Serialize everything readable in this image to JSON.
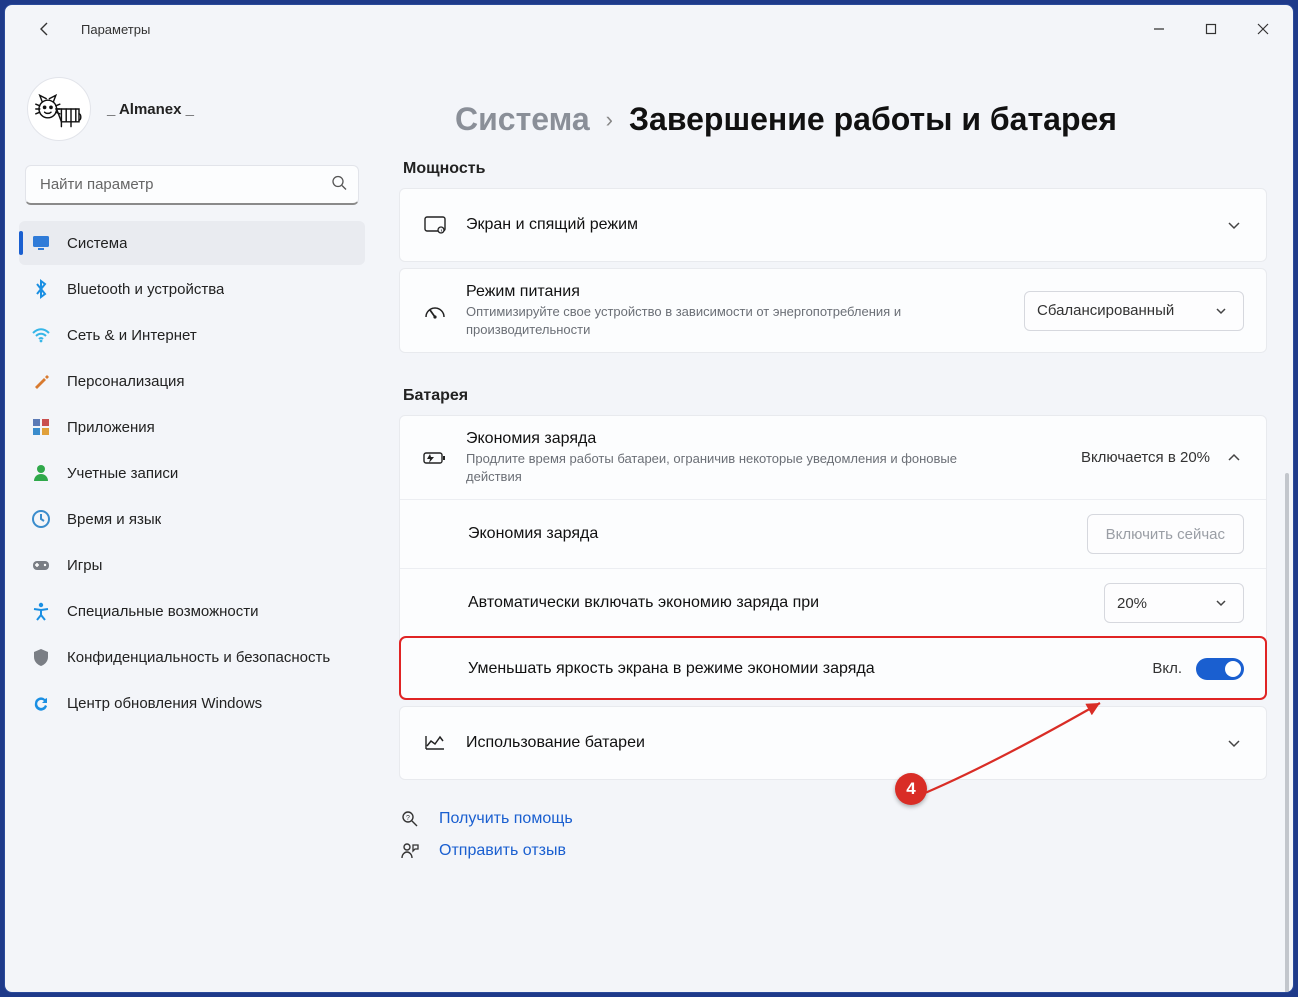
{
  "app": {
    "title": "Параметры"
  },
  "user": {
    "name": "_ Almanex _"
  },
  "search": {
    "placeholder": "Найти параметр"
  },
  "nav": {
    "items": [
      {
        "label": "Система",
        "icon": "monitor",
        "color": "#2f7bd8",
        "active": true
      },
      {
        "label": "Bluetooth и устройства",
        "icon": "bluetooth",
        "color": "#1a8fe3"
      },
      {
        "label": "Сеть & и Интернет",
        "icon": "wifi",
        "color": "#36b6e8"
      },
      {
        "label": "Персонализация",
        "icon": "brush",
        "color": "#d87a2f"
      },
      {
        "label": "Приложения",
        "icon": "apps",
        "color": "#5b7ab5"
      },
      {
        "label": "Учетные записи",
        "icon": "person",
        "color": "#2fa84a"
      },
      {
        "label": "Время и язык",
        "icon": "clock",
        "color": "#3a8ccc"
      },
      {
        "label": "Игры",
        "icon": "gamepad",
        "color": "#7a7e85"
      },
      {
        "label": "Специальные возможности",
        "icon": "accessibility",
        "color": "#1a8fe3"
      },
      {
        "label": "Конфиденциальность и безопасность",
        "icon": "shield",
        "color": "#7a7e85"
      },
      {
        "label": "Центр обновления Windows",
        "icon": "update",
        "color": "#1a8fe3"
      }
    ]
  },
  "breadcrumb": {
    "parent": "Система",
    "sep": "›",
    "current": "Завершение работы и батарея"
  },
  "sections": {
    "power": {
      "label": "Мощность",
      "screen": {
        "title": "Экран и спящий режим"
      },
      "mode": {
        "title": "Режим питания",
        "sub": "Оптимизируйте свое устройство в зависимости от энергопотребления и производительности",
        "value": "Сбалансированный"
      }
    },
    "battery": {
      "label": "Батарея",
      "saver": {
        "title": "Экономия заряда",
        "sub": "Продлите время работы батареи, ограничив некоторые уведомления и фоновые действия",
        "status": "Включается в 20%",
        "row1_label": "Экономия заряда",
        "row1_button": "Включить сейчас",
        "row2_label": "Автоматически включать экономию заряда при",
        "row2_value": "20%",
        "row3_label": "Уменьшать яркость экрана в режиме экономии заряда",
        "row3_toggle_text": "Вкл."
      },
      "usage": {
        "title": "Использование батареи"
      }
    }
  },
  "footer": {
    "help": "Получить помощь",
    "feedback": "Отправить отзыв"
  },
  "annotation": {
    "badge": "4"
  }
}
